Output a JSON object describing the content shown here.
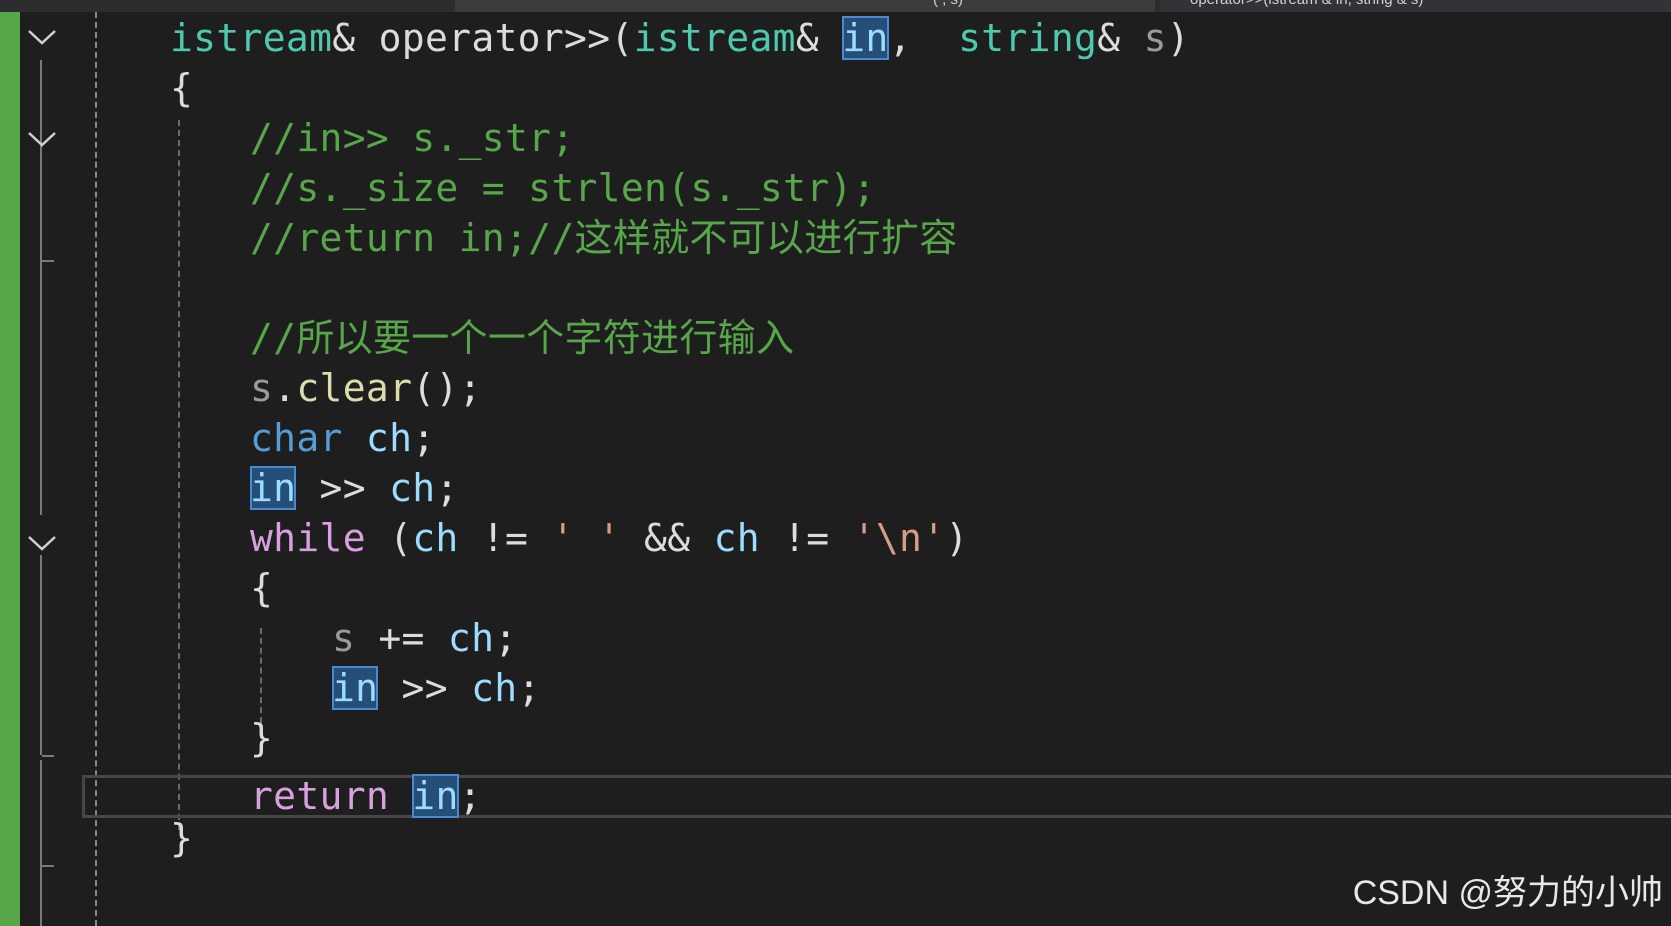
{
  "tabs": {
    "left_fragment": "(  , s)",
    "right_fragment": "operator>>(istream & in, string & s)"
  },
  "code": {
    "l1": {
      "a": "istream",
      "b": "&",
      "c": " operator>>",
      "d": "(",
      "e": "istream",
      "f": "&",
      "g": " ",
      "h": "in",
      "i": ",  ",
      "j": "string",
      "k": "&",
      "l": " s",
      "m": ")"
    },
    "l2": {
      "a": "{"
    },
    "l3": {
      "a": "//in>> s._str;"
    },
    "l4": {
      "a": "//s._size = strlen(s._str);"
    },
    "l5": {
      "a": "//return in;//这样就不可以进行扩容"
    },
    "l7": {
      "a": "//所以要一个一个字符进行输入"
    },
    "l8": {
      "a": "s",
      "b": ".",
      "c": "clear",
      "d": "()",
      "e": ";"
    },
    "l9": {
      "a": "char",
      "b": " ",
      "c": "ch",
      "d": ";"
    },
    "l10": {
      "a": "in",
      "b": " >> ",
      "c": "ch",
      "d": ";"
    },
    "l11": {
      "a": "while",
      "b": " (",
      "c": "ch",
      "d": " != ",
      "e": "' '",
      "f": " && ",
      "g": "ch",
      "h": " != ",
      "i": "'\\n'",
      "j": ")"
    },
    "l12": {
      "a": "{"
    },
    "l13": {
      "a": "s",
      "b": " += ",
      "c": "ch",
      "d": ";"
    },
    "l14": {
      "a": "in",
      "b": " >> ",
      "c": "ch",
      "d": ";"
    },
    "l15": {
      "a": "}"
    },
    "l16": {
      "a": "return",
      "b": " ",
      "c": "in",
      "d": ";"
    },
    "l17": {
      "a": "}"
    }
  },
  "icons": {
    "fold": "chevron-down-icon",
    "tab": "method-icon"
  },
  "colors": {
    "keyword": "#d8a0df",
    "type": "#4ec9b0",
    "builtin_keyword": "#569cd6",
    "function": "#dcdcaa",
    "variable": "#9cdcfe",
    "comment": "#57a64a",
    "string": "#d69d85",
    "highlight": "#264f78",
    "change_bar": "#57a64a",
    "background": "#1e1e1e"
  },
  "watermark": "CSDN @努力的小帅"
}
